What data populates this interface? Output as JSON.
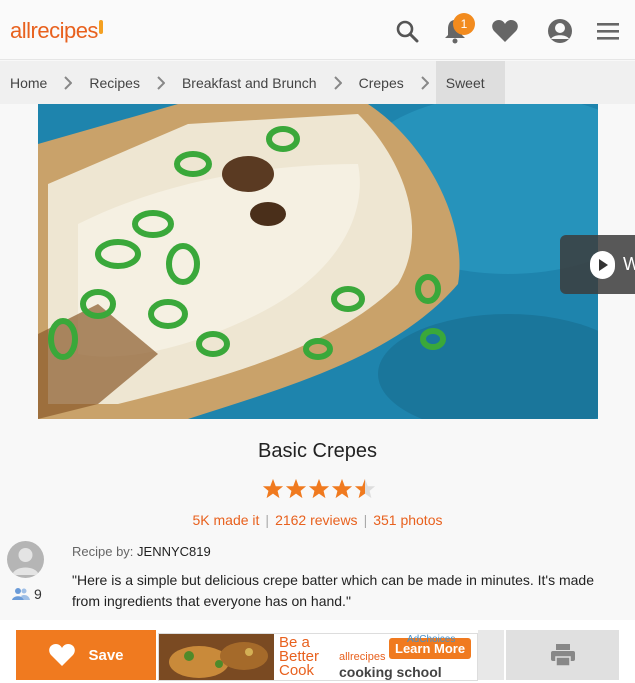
{
  "header": {
    "logo_text": "allrecipes",
    "notification_count": "1",
    "icons": [
      "search-icon",
      "bell-icon",
      "heart-icon",
      "user-icon",
      "menu-icon"
    ]
  },
  "breadcrumb": [
    {
      "label": "Home"
    },
    {
      "label": "Recipes"
    },
    {
      "label": "Breakfast and Brunch"
    },
    {
      "label": "Crepes"
    },
    {
      "label": "Sweet"
    }
  ],
  "video_button": {
    "label": "W"
  },
  "recipe": {
    "title": "Basic Crepes",
    "rating": 4.5,
    "made_it": "5K made it",
    "reviews": "2162 reviews",
    "photos": "351 photos",
    "recipe_by_label": "Recipe by:",
    "author": "JENNYC819",
    "followers": "9",
    "description": "\"Here is a simple but delicious crepe batter which can be made in minutes. It's made from ingredients that everyone has on hand.\""
  },
  "actions": {
    "save_label": "Save"
  },
  "ad": {
    "tagline_1": "Be a",
    "tagline_2": "Better",
    "tagline_3": "Cook",
    "brand": "allrecipes",
    "cta": "Learn More",
    "product": "cooking school",
    "choices": "AdChoices"
  },
  "colors": {
    "accent": "#f07a1f",
    "star": "#f07a1f",
    "badge": "#f28b1e"
  }
}
